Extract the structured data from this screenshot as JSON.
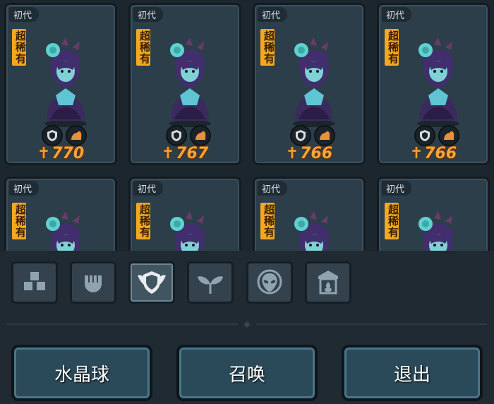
{
  "cards": [
    {
      "generation": "初代",
      "rarity": "超稀有",
      "power": "770"
    },
    {
      "generation": "初代",
      "rarity": "超稀有",
      "power": "767"
    },
    {
      "generation": "初代",
      "rarity": "超稀有",
      "power": "766"
    },
    {
      "generation": "初代",
      "rarity": "超稀有",
      "power": "766"
    },
    {
      "generation": "初代",
      "rarity": "超稀有",
      "power": ""
    },
    {
      "generation": "初代",
      "rarity": "超稀有",
      "power": ""
    },
    {
      "generation": "初代",
      "rarity": "超稀有",
      "power": ""
    },
    {
      "generation": "初代",
      "rarity": "超稀有",
      "power": ""
    }
  ],
  "filters": [
    {
      "icon": "blocks-icon",
      "active": false
    },
    {
      "icon": "fist-icon",
      "active": false
    },
    {
      "icon": "shield-wings-icon",
      "active": true
    },
    {
      "icon": "sprout-icon",
      "active": false
    },
    {
      "icon": "alien-icon",
      "active": false
    },
    {
      "icon": "shrine-icon",
      "active": false
    }
  ],
  "actions": {
    "crystal_ball": "水晶球",
    "summon": "召唤",
    "exit": "退出"
  },
  "colors": {
    "power": "#f5a53a",
    "rarity_badge": "#f2a91e",
    "card_bg": "#2c3e4a",
    "button_bg": "#2a4a5a"
  }
}
